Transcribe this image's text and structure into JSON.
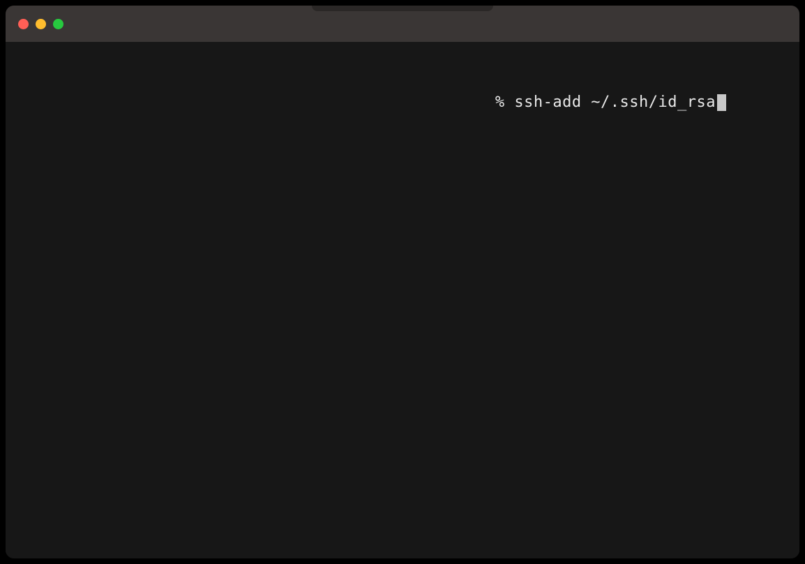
{
  "window": {
    "traffic_lights": {
      "close_color": "#ff5f56",
      "minimize_color": "#ffbd2e",
      "maximize_color": "#27c93f"
    }
  },
  "terminal": {
    "prompt": "% ",
    "command": "ssh-add ~/.ssh/id_rsa",
    "cursor_visible": true,
    "background_color": "#171717",
    "text_color": "#e8e8e8"
  }
}
